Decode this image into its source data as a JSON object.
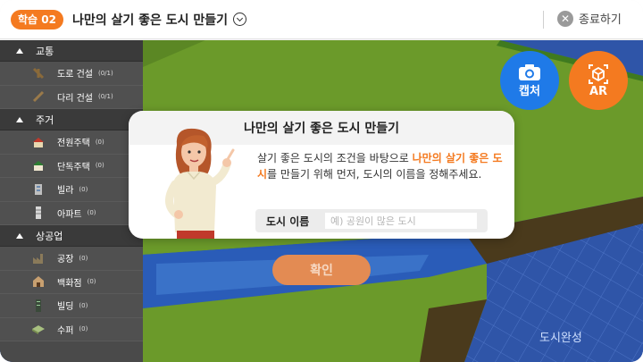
{
  "header": {
    "lesson_badge": "학습 02",
    "title": "나만의 살기 좋은 도시 만들기",
    "exit_label": "종료하기"
  },
  "sidebar": {
    "categories": [
      {
        "label": "교통",
        "items": [
          {
            "label": "도로 건설",
            "count": "(0/1)",
            "icon": "road-icon"
          },
          {
            "label": "다리 건설",
            "count": "(0/1)",
            "icon": "bridge-icon"
          }
        ]
      },
      {
        "label": "주거",
        "items": [
          {
            "label": "전원주택",
            "count": "(0)",
            "icon": "country-house-icon"
          },
          {
            "label": "단독주택",
            "count": "(0)",
            "icon": "house-icon"
          },
          {
            "label": "빌라",
            "count": "(0)",
            "icon": "villa-icon"
          },
          {
            "label": "아파트",
            "count": "(0)",
            "icon": "apartment-icon"
          }
        ]
      },
      {
        "label": "상공업",
        "items": [
          {
            "label": "공장",
            "count": "(0)",
            "icon": "factory-icon"
          },
          {
            "label": "백화점",
            "count": "(0)",
            "icon": "department-store-icon"
          },
          {
            "label": "빌딩",
            "count": "(0)",
            "icon": "building-icon"
          },
          {
            "label": "수퍼",
            "count": "(0)",
            "icon": "supermarket-icon"
          }
        ]
      }
    ]
  },
  "buttons": {
    "capture_label": "캡처",
    "ar_label": "AR",
    "confirm_label": "확인",
    "complete_label": "도시완성"
  },
  "modal": {
    "title": "나만의 살기 좋은 도시 만들기",
    "body_part1": "살기 좋은 도시의 조건을 바탕으로 ",
    "body_highlight": "나만의 살기 좋은 도시",
    "body_part2": "를 만들기 위해 먼저, 도시의 이름을 정해주세요.",
    "name_label": "도시 이름",
    "name_placeholder": "예) 공원이 많은 도시",
    "name_value": ""
  },
  "colors": {
    "accent_orange": "#f47a20",
    "accent_blue": "#1f7ae8",
    "grass": "#6b9a2a",
    "water": "#2f55a8"
  }
}
